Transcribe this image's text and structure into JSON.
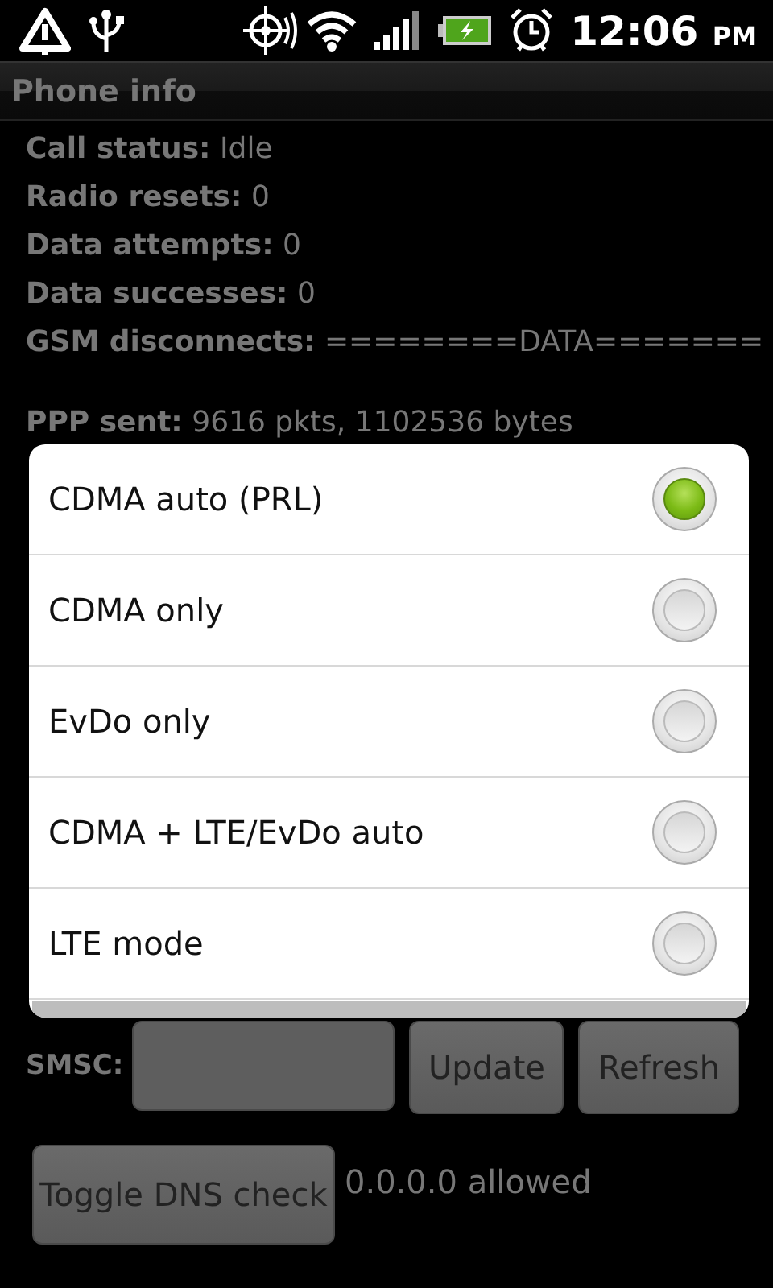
{
  "status_bar": {
    "time": "12:06",
    "meridiem": "PM"
  },
  "title": "Phone info",
  "info": [
    {
      "text": "**Call status:** Idle"
    },
    {
      "text": "**Radio resets:** 0"
    },
    {
      "text": "**Data attempts:** 0"
    },
    {
      "text": "**Data successes:** 0"
    },
    {
      "text": "**GSM disconnects:** ========DATA======="
    }
  ],
  "traffic": [
    {
      "text": "**PPP sent:** 9616 pkts, 1102536 bytes"
    }
  ],
  "smsc": {
    "label": "SMSC:",
    "buttons": [
      "Update",
      "Refresh"
    ]
  },
  "dns": {
    "button": "Toggle DNS check",
    "status": "0.0.0.0 allowed"
  },
  "dialog": {
    "options": [
      {
        "label": "CDMA auto (PRL)",
        "selected": true
      },
      {
        "label": "CDMA only",
        "selected": false
      },
      {
        "label": "EvDo only",
        "selected": false
      },
      {
        "label": "CDMA + LTE/EvDo auto",
        "selected": false
      },
      {
        "label": "LTE mode",
        "selected": false
      }
    ]
  }
}
